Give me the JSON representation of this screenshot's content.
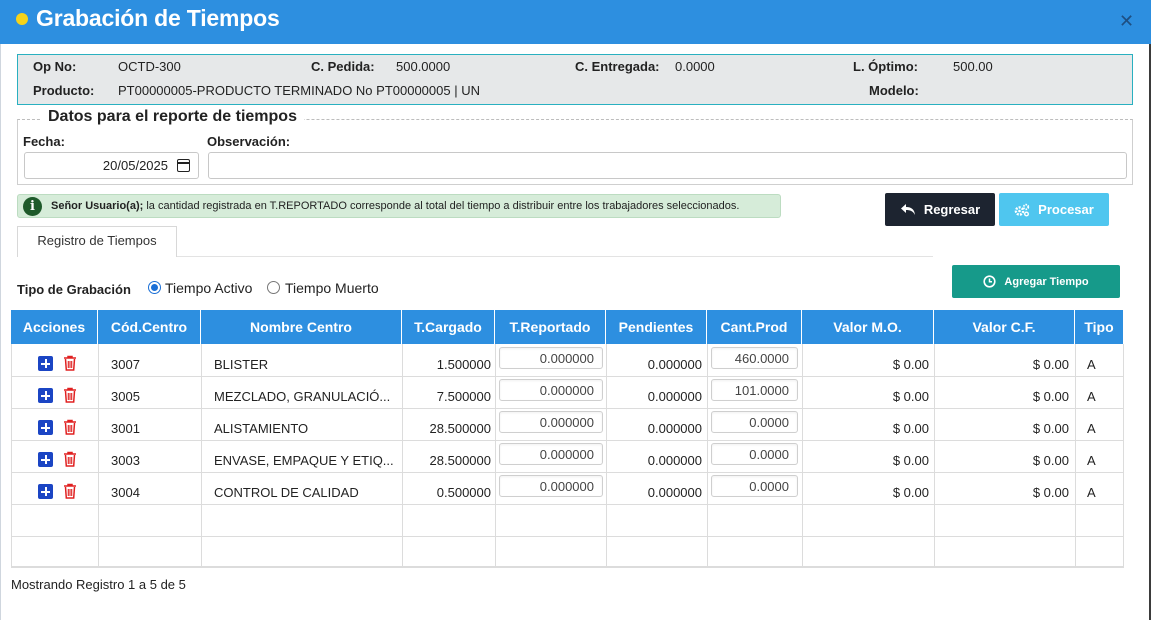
{
  "window": {
    "title": "Grabación de Tiempos"
  },
  "info": {
    "op_no_label": "Op No:",
    "op_no": "OCTD-300",
    "c_pedida_label": "C. Pedida:",
    "c_pedida": "500.0000",
    "c_entregada_label": "C. Entregada:",
    "c_entregada": "0.0000",
    "l_optimo_label": "L. Óptimo:",
    "l_optimo": "500.00",
    "producto_label": "Producto:",
    "producto": "PT00000005-PRODUCTO TERMINADO No PT00000005 | UN",
    "modelo_label": "Modelo:",
    "modelo": ""
  },
  "report": {
    "legend": "Datos para el reporte de tiempos",
    "fecha_label": "Fecha:",
    "fecha": "20/05/2025",
    "observacion_label": "Observación:",
    "observacion": ""
  },
  "alert": {
    "bold": "Señor Usuario(a);",
    "text": " la cantidad registrada en T.REPORTADO corresponde al total del tiempo a distribuir entre los trabajadores seleccionados."
  },
  "buttons": {
    "regresar": "Regresar",
    "procesar": "Procesar",
    "agregar": "Agregar Tiempo"
  },
  "tabs": [
    {
      "label": "Registro de Tiempos"
    }
  ],
  "tipo": {
    "label": "Tipo de Grabación",
    "activo": "Tiempo Activo",
    "muerto": "Tiempo Muerto",
    "selected": "activo"
  },
  "table": {
    "headers": [
      "Acciones",
      "Cód.Centro",
      "Nombre Centro",
      "T.Cargado",
      "T.Reportado",
      "Pendientes",
      "Cant.Prod",
      "Valor M.O.",
      "Valor C.F.",
      "Tipo"
    ],
    "rows": [
      {
        "codigo": "3007",
        "nombre": "BLISTER",
        "cargado": "1.500000",
        "reportado": "0.000000",
        "pendientes": "0.000000",
        "cant": "460.0000",
        "mo": "$ 0.00",
        "cf": "$ 0.00",
        "tipo": "A"
      },
      {
        "codigo": "3005",
        "nombre": "MEZCLADO, GRANULACIÓ...",
        "cargado": "7.500000",
        "reportado": "0.000000",
        "pendientes": "0.000000",
        "cant": "101.0000",
        "mo": "$ 0.00",
        "cf": "$ 0.00",
        "tipo": "A"
      },
      {
        "codigo": "3001",
        "nombre": "ALISTAMIENTO",
        "cargado": "28.500000",
        "reportado": "0.000000",
        "pendientes": "0.000000",
        "cant": "0.0000",
        "mo": "$ 0.00",
        "cf": "$ 0.00",
        "tipo": "A"
      },
      {
        "codigo": "3003",
        "nombre": "ENVASE, EMPAQUE Y ETIQ...",
        "cargado": "28.500000",
        "reportado": "0.000000",
        "pendientes": "0.000000",
        "cant": "0.0000",
        "mo": "$ 0.00",
        "cf": "$ 0.00",
        "tipo": "A"
      },
      {
        "codigo": "3004",
        "nombre": "CONTROL DE CALIDAD",
        "cargado": "0.500000",
        "reportado": "0.000000",
        "pendientes": "0.000000",
        "cant": "0.0000",
        "mo": "$ 0.00",
        "cf": "$ 0.00",
        "tipo": "A"
      }
    ]
  },
  "footer": {
    "text": "Mostrando Registro 1 a 5 de 5"
  },
  "icons": {
    "title": "status-dot-icon",
    "close": "close-icon",
    "alert": "info-icon",
    "regresar": "reply-arrow-icon",
    "procesar": "gears-icon",
    "agregar": "clock-icon",
    "add": "plus-square-icon",
    "delete": "trash-icon",
    "calendar": "calendar-icon"
  },
  "colors": {
    "header": "#2d8fe0",
    "regresar": "#1d2430",
    "procesar": "#4fc6ef",
    "agregar": "#169a8a",
    "alert_bg": "#d6ecd9",
    "delete": "#e02020"
  }
}
